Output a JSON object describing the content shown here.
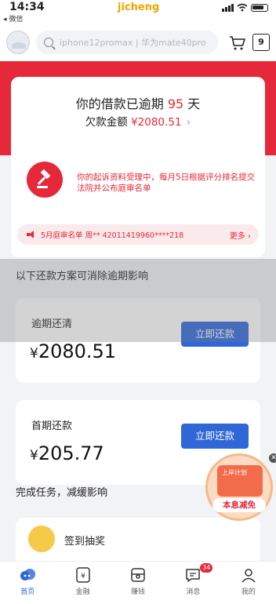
{
  "status_bar": {
    "time": "14:34",
    "back_label": "◂ 微信",
    "watermark": "jicheng"
  },
  "search": {
    "placeholder": "iphone12promax | 华为mate40pro",
    "bag_count": "9"
  },
  "debt_card": {
    "overdue_prefix": "你的借款已逾期",
    "overdue_days": "95",
    "overdue_suffix": "天",
    "debt_prefix": "欠款金额",
    "debt_amount": "¥2080.51",
    "debt_chevron": "›",
    "warning_text": "你的起诉资料受理中，每月5日根据评分排名提交法院并公布庭审名单",
    "marquee_text": "5月庭审名单 周** 42011419960****218",
    "more_label": "更多"
  },
  "repay_section": {
    "title": "以下还款方案可消除逾期影响",
    "options": [
      {
        "label": "逾期还清",
        "currency": "¥",
        "amount": "2080.51",
        "button": "立即还款"
      },
      {
        "label": "首期还款",
        "currency": "¥",
        "amount": "205.77",
        "button": "立即还款"
      }
    ]
  },
  "task_section": {
    "title": "完成任务，减缓影响",
    "task_label": "签到抽奖"
  },
  "float_badge": {
    "tag": "上岸计划",
    "label": "本息减免",
    "close": "✕"
  },
  "tabs": [
    {
      "label": "首页",
      "icon": "home-icon"
    },
    {
      "label": "金融",
      "icon": "finance-icon"
    },
    {
      "label": "赚钱",
      "icon": "wallet-icon"
    },
    {
      "label": "消息",
      "icon": "message-icon",
      "badge": "34"
    },
    {
      "label": "我的",
      "icon": "profile-icon"
    }
  ],
  "colors": {
    "brand_red": "#e5283a",
    "button_blue": "#2f66d8"
  }
}
